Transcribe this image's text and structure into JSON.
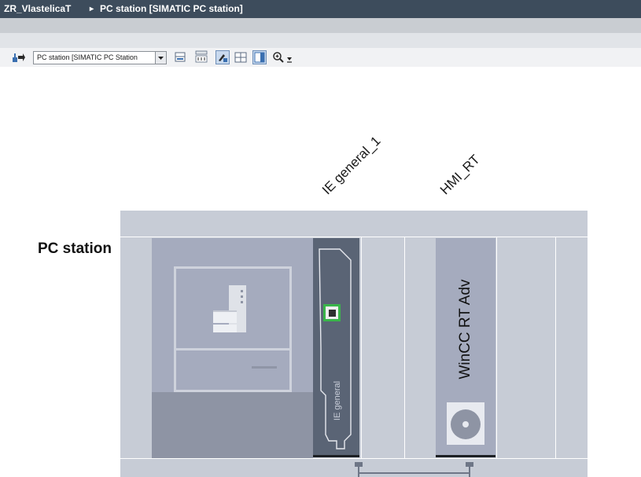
{
  "titlebar": {
    "project": "ZR_VlastelicaT",
    "separator": "▸",
    "device": "PC station [SIMATIC PC station]"
  },
  "toolbar": {
    "device_select": "PC station [SIMATIC PC Station",
    "icons": [
      "device-overview-icon",
      "network-view-icon",
      "wire-icon",
      "show-modules-icon",
      "page-layout-icon",
      "grid-icon",
      "zoom-icon"
    ]
  },
  "rack": {
    "label": "PC station",
    "slots": [
      {
        "column_label": "IE general_1",
        "card_label": "IE general"
      },
      {
        "column_label": "HMI_RT",
        "card_label": "WinCC RT Adv"
      }
    ]
  },
  "colors": {
    "titlebar": "#3d4c5c",
    "rack": "#c7ccd6",
    "card": "#5a6475",
    "port_highlight": "#3ab54a"
  }
}
